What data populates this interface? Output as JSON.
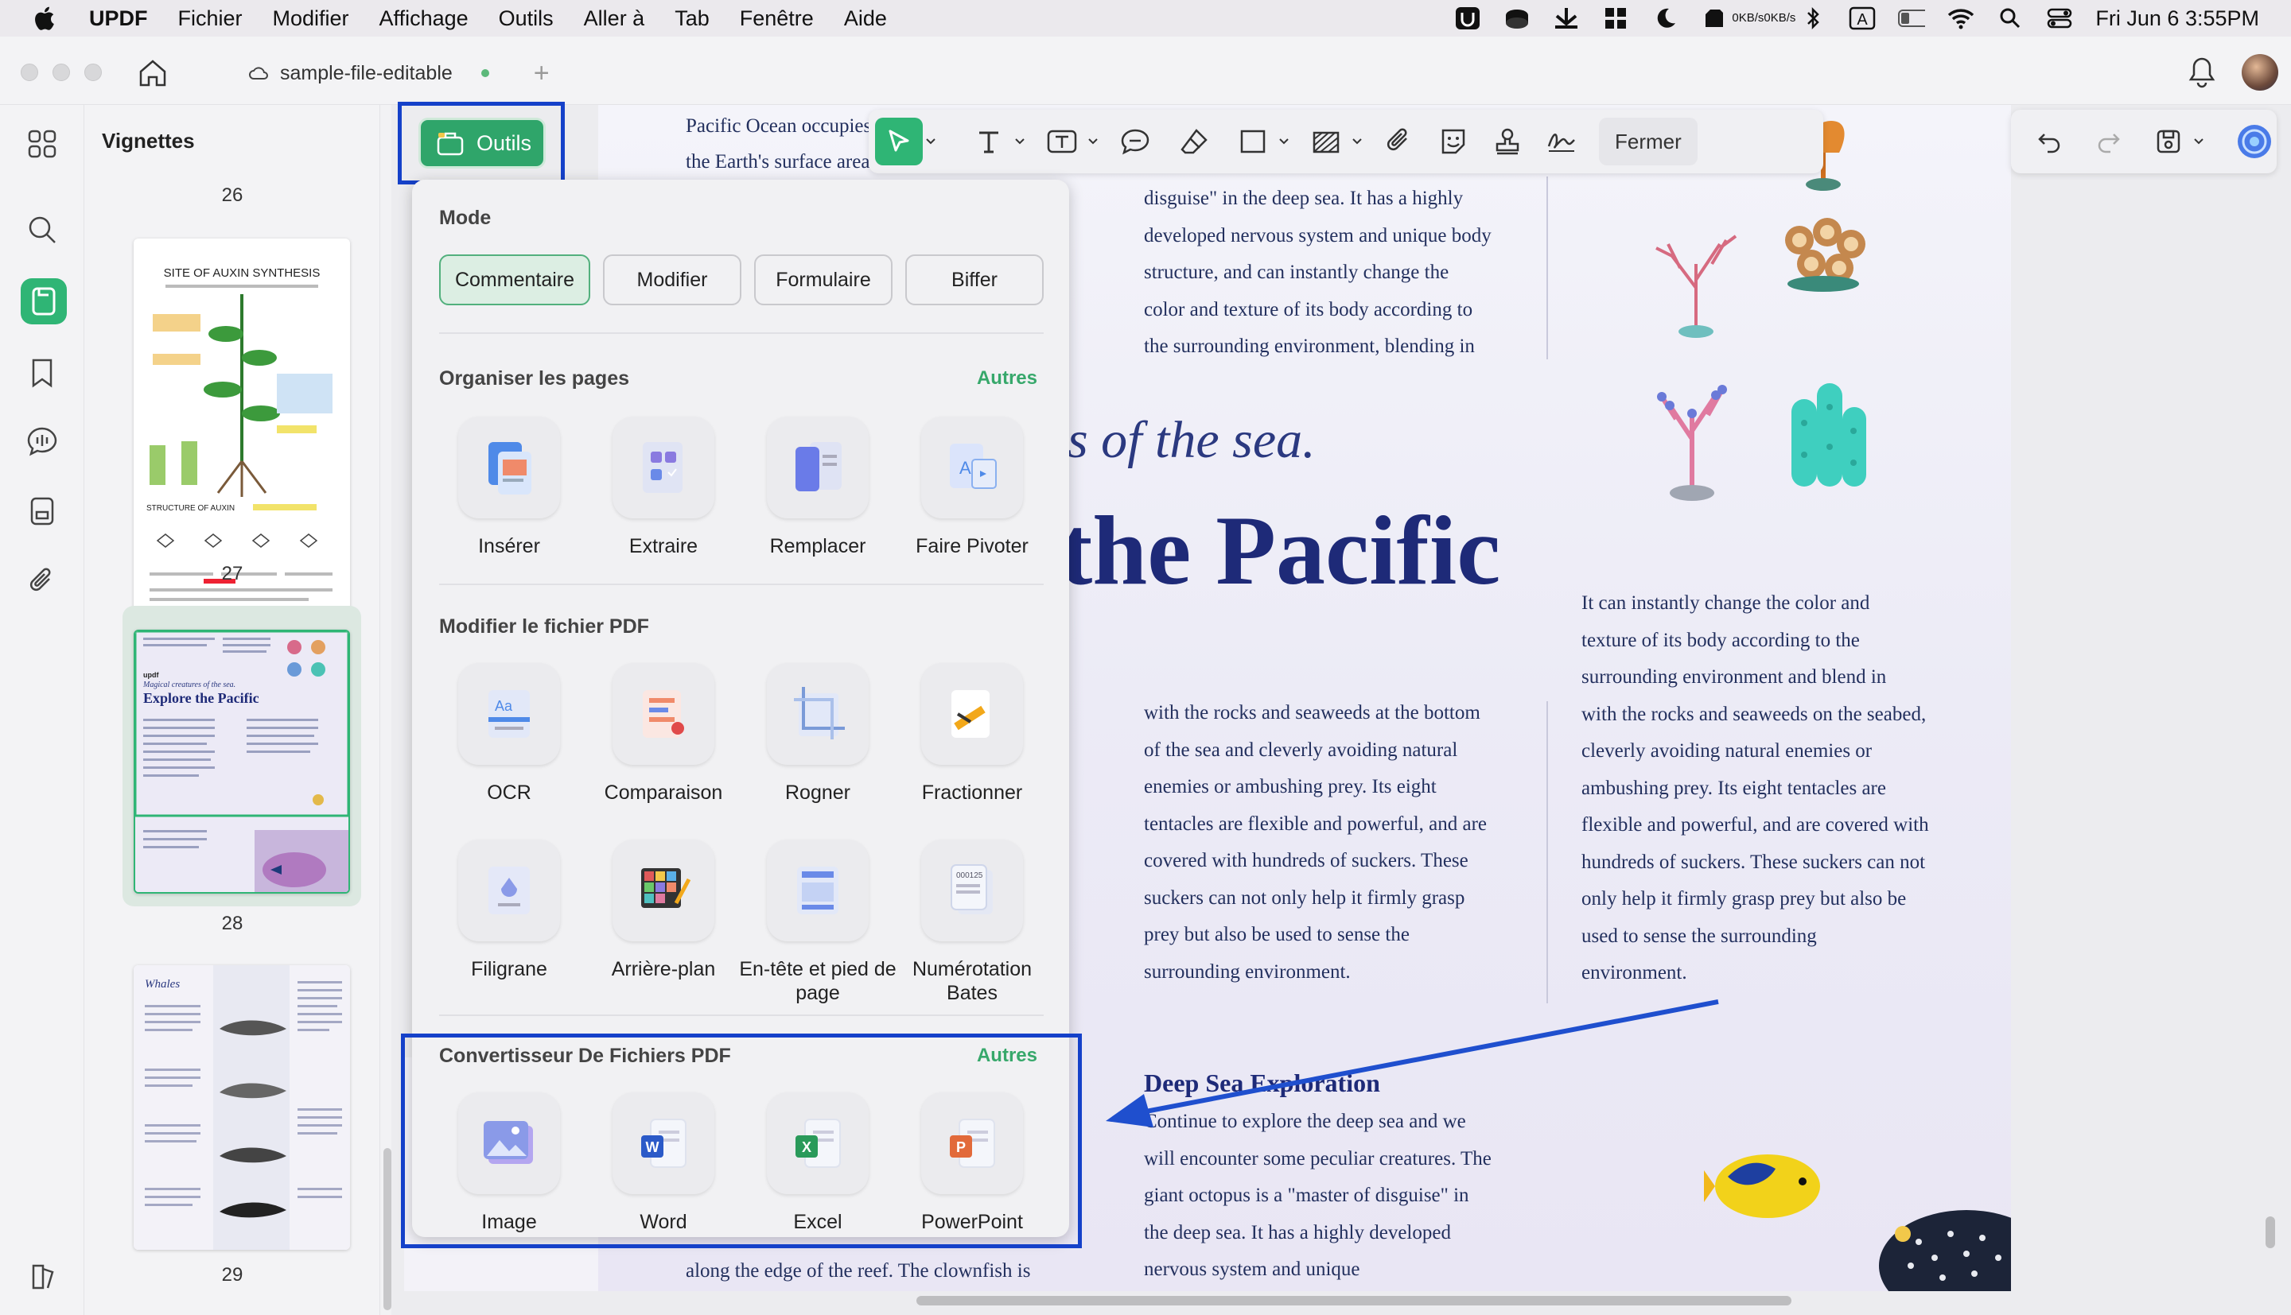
{
  "menubar": {
    "app": "UPDF",
    "items": [
      "Fichier",
      "Modifier",
      "Affichage",
      "Outils",
      "Aller à",
      "Tab",
      "Fenêtre",
      "Aide"
    ],
    "net_up": "0KB/s",
    "net_down": "0KB/s",
    "datetime": "Fri Jun 6  3:55PM"
  },
  "window": {
    "tab_title": "sample-file-editable"
  },
  "thumbnails": {
    "title": "Vignettes",
    "page_numbers": [
      "26",
      "27",
      "28",
      "29"
    ],
    "t27_title": "SITE OF AUXIN SYNTHESIS",
    "t27_sub": "STRUCTURE OF AUXIN",
    "t28_logo": "updf",
    "t28_sub": "Magical creatures of the sea.",
    "t28_title": "Explore the Pacific",
    "t29_title": "Whales"
  },
  "toolbar": {
    "outils_label": "Outils",
    "close_label": "Fermer"
  },
  "panel": {
    "mode_title": "Mode",
    "modes": [
      "Commentaire",
      "Modifier",
      "Formulaire",
      "Biffer"
    ],
    "organize_title": "Organiser les pages",
    "organize_more": "Autres",
    "organize_tools": [
      "Insérer",
      "Extraire",
      "Remplacer",
      "Faire Pivoter"
    ],
    "edit_title": "Modifier le fichier PDF",
    "edit_tools": [
      "OCR",
      "Comparaison",
      "Rogner",
      "Fractionner",
      "Filigrane",
      "Arrière-plan",
      "En-tête et pied de page",
      "Numérotation Bates"
    ],
    "convert_title": "Convertisseur De Fichiers PDF",
    "convert_more": "Autres",
    "convert_tools": [
      "Image",
      "Word",
      "Excel",
      "PowerPoint"
    ]
  },
  "document": {
    "top_left_1": "Pacific Ocean occupies",
    "top_left_2": "the Earth's surface area",
    "col1_top": [
      "disguise\" in the deep sea. It has a highly",
      "developed nervous system and unique body",
      "structure, and can instantly change the",
      "color and texture of its body according to",
      "the surrounding environment, blending in"
    ],
    "heading_italic": "s of the sea.",
    "heading_big": "the Pacific",
    "col1_mid": [
      "with the rocks and seaweeds at the bottom",
      "of the sea and cleverly avoiding natural",
      "enemies or ambushing prey. Its eight",
      "tentacles are flexible and powerful, and are",
      "covered with hundreds of suckers. These",
      "suckers can not only help it firmly grasp",
      "prey but also be used to sense the",
      "surrounding environment."
    ],
    "col2": [
      "It can instantly change the color and",
      "texture of its body according to the",
      "surrounding environment and blend in",
      "with the rocks and seaweeds on the seabed,",
      "cleverly avoiding natural enemies or",
      "ambushing prey. Its eight tentacles are",
      "flexible and powerful, and are covered with",
      "hundreds of suckers. These suckers can not",
      "only help it firmly grasp prey but also be",
      "used to sense the surrounding",
      "environment."
    ],
    "section_title": "Deep Sea Exploration",
    "section_body": [
      "Continue to explore the deep sea and we",
      "will encounter some peculiar creatures. The",
      "giant octopus is a \"master of disguise\" in",
      "the deep sea. It has a highly developed",
      "nervous system and unique"
    ],
    "bottom_left": "along the edge of the reef. The clownfish is"
  },
  "colors": {
    "accent_green": "#2fb575",
    "highlight_blue": "#1541c9",
    "heading_navy": "#1e2a78"
  }
}
